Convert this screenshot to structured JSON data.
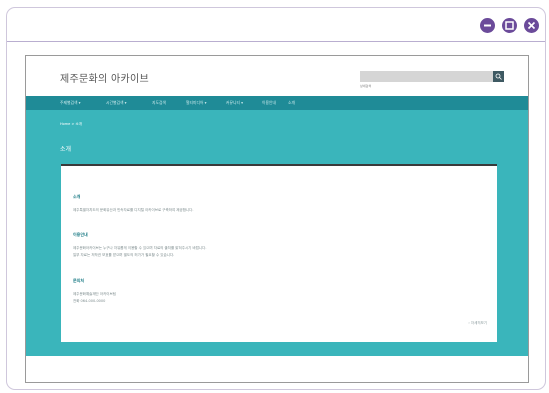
{
  "window": {
    "buttons": [
      "minimize",
      "maximize",
      "close"
    ],
    "accent": "#6b4b9a"
  },
  "site": {
    "title": "제주문화의 아카이브",
    "search_sub": "상세검색",
    "nav": [
      "주제별검색 ▾",
      "시간별검색 ▾",
      "지도검색",
      "멀티미디어 ▾",
      "커뮤니티 ▾",
      "이용안내",
      "소개"
    ],
    "breadcrumb": "Home > 소개",
    "heading": "소개"
  },
  "card": {
    "section1_title": "소개",
    "section1_body": "제주특별자치도의 문화유산과 민속자료를 디지털 아카이브로 구축하여 제공합니다.",
    "section2_title": "이용안내",
    "section2_line1": "제주문화아카이브는 누구나 자유롭게 이용할 수 있으며 자료의 출처를 밝혀주시기 바랍니다.",
    "section2_line2": "일부 자료는 저작권 보호를 받으며 별도의 허가가 필요할 수 있습니다.",
    "section3_title": "문의처",
    "section3_line1": "제주문화예술재단 아카이브팀",
    "section3_line2": "전화 064-000-0000",
    "more": "› 자세히보기"
  },
  "colors": {
    "nav": "#1f8b97",
    "content": "#3ab5bb"
  }
}
